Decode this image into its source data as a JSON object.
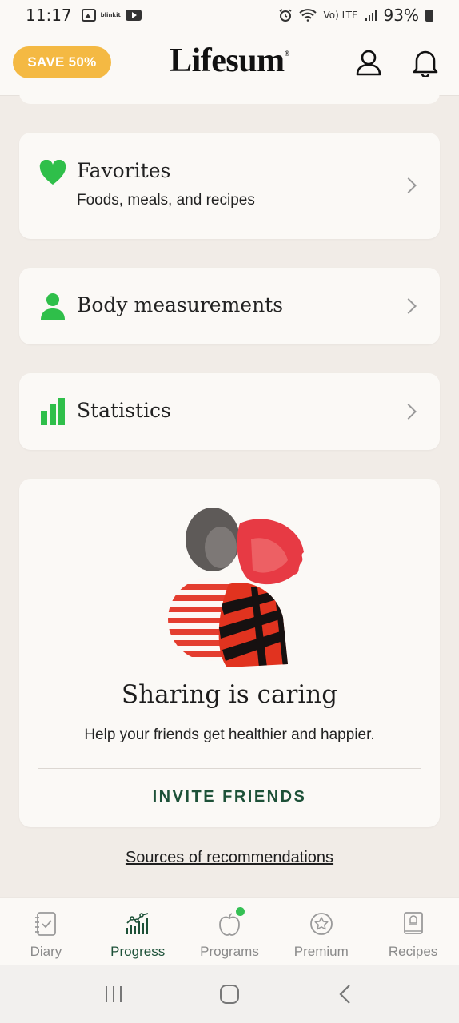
{
  "status_bar": {
    "time": "11:17",
    "app_badge": "blinkit",
    "network": "Vo) LTE",
    "battery": "93%"
  },
  "header": {
    "promo_label": "SAVE 50%",
    "logo": "Lifesum",
    "logo_mark": "®",
    "colors": {
      "promo": "#f4b943"
    }
  },
  "rows": [
    {
      "title": "Favorites",
      "subtitle": "Foods, meals, and recipes",
      "icon": "heart-icon"
    },
    {
      "title": "Body measurements",
      "icon": "person-icon"
    },
    {
      "title": "Statistics",
      "icon": "bar-chart-icon"
    }
  ],
  "share_card": {
    "title": "Sharing is caring",
    "subtitle": "Help your friends get healthier and happier.",
    "cta": "INVITE FRIENDS"
  },
  "sources_link": "Sources of recommendations",
  "bottom_nav": {
    "items": [
      {
        "label": "Diary",
        "icon": "diary-icon",
        "active": false
      },
      {
        "label": "Progress",
        "icon": "progress-chart-icon",
        "active": true
      },
      {
        "label": "Programs",
        "icon": "apple-icon",
        "active": false
      },
      {
        "label": "Premium",
        "icon": "star-badge-icon",
        "active": false
      },
      {
        "label": "Recipes",
        "icon": "recipe-book-icon",
        "active": false
      }
    ]
  },
  "colors": {
    "accent_green": "#35c054",
    "active_nav": "#1d5138",
    "background": "#f1ece7",
    "card": "#fbf9f6"
  }
}
